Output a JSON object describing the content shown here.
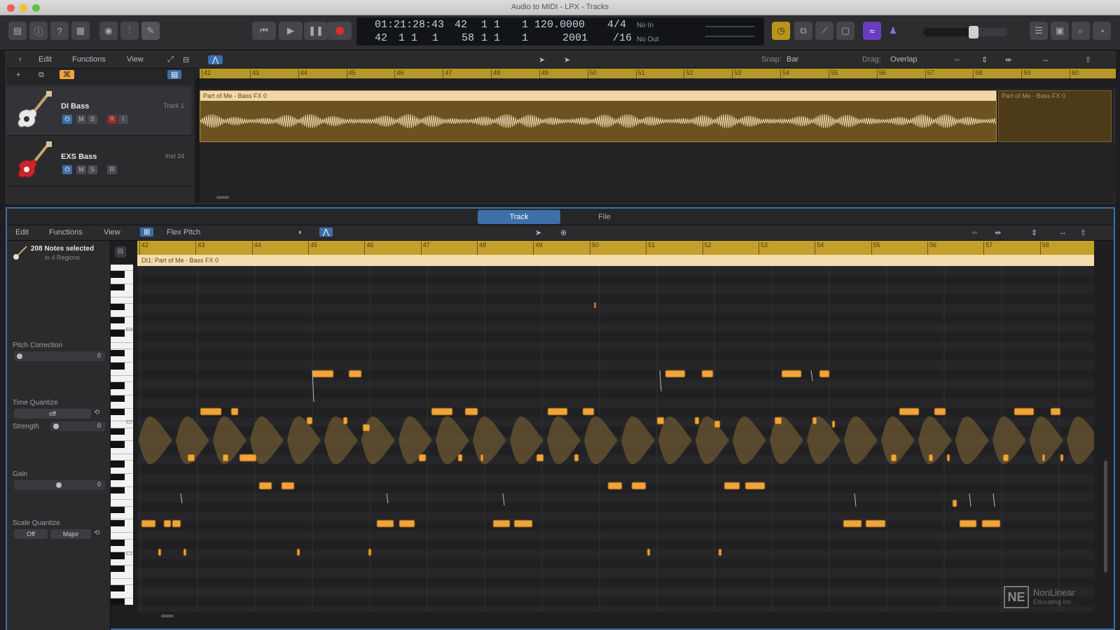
{
  "window": {
    "title": "Audio to MIDI - LPX - Tracks"
  },
  "colors": {
    "accent": "#3d6fa8",
    "region": "#b58d3a",
    "note": "#f0a43a",
    "ruler": "#c3a02c",
    "record": "#d62d2d"
  },
  "control_bar": {
    "icons": [
      "library-icon",
      "inspector-icon",
      "quick-help-icon",
      "toolbar-icon",
      "smart-controls-icon",
      "mixer-icon",
      "editors-icon"
    ],
    "transport": [
      "rewind-icon",
      "play-icon",
      "pause-icon",
      "record-icon"
    ],
    "lcd": {
      "time": "01:21:28:43",
      "bars_top": [
        "42",
        "1",
        "1",
        "1"
      ],
      "tempo": "120.0000",
      "signature": "4/4",
      "bars_bottom": [
        "42",
        "1",
        "1",
        "1"
      ],
      "bars_bottom_2": [
        "58",
        "1",
        "1",
        "1"
      ],
      "tempo_bottom": "2001",
      "division": "/16",
      "midi_in": "No In",
      "midi_out": "No Out"
    },
    "right_icons": [
      "metronome-icon",
      "count-in-icon",
      "tuner-icon",
      "solo-icon",
      "replace-icon",
      "tuning-icon"
    ],
    "volume": 0.6
  },
  "tracks_area": {
    "menu": [
      "Edit",
      "Functions",
      "View"
    ],
    "snap_label": "Snap:",
    "snap_value": "Bar",
    "drag_label": "Drag:",
    "drag_value": "Overlap",
    "ruler": [
      "42",
      "43",
      "44",
      "45",
      "46",
      "47",
      "48",
      "49",
      "50",
      "51",
      "52",
      "53",
      "54",
      "55",
      "56",
      "57",
      "58",
      "59",
      "60"
    ],
    "tracks": [
      {
        "name": "DI Bass",
        "sub": "Track 1",
        "buttons": [
          "M",
          "S",
          "R",
          "I"
        ]
      },
      {
        "name": "EXS Bass",
        "sub": "Inst 34",
        "buttons": [
          "M",
          "S",
          "R"
        ]
      }
    ],
    "region": {
      "name": "Part of Me - Bass FX 0"
    },
    "region_after": {
      "name": "Part of Me - Bass FX 0"
    }
  },
  "editor": {
    "tabs": [
      "Track",
      "File"
    ],
    "active_tab": "Track",
    "menu": [
      "Edit",
      "Functions",
      "View"
    ],
    "mode": "Flex Pitch",
    "selection": {
      "title": "208 Notes selected",
      "subtitle": "in 4 Regions"
    },
    "inspector": {
      "pitch_correction": "Pitch Correction",
      "pitch_value": "0",
      "time_quantize": "Time Quantize",
      "time_quantize_value": "off",
      "strength": "Strength",
      "strength_value": "0",
      "gain": "Gain",
      "gain_value": "0",
      "scale_quantize": "Scale Quantize",
      "scale_off": "Off",
      "scale_mode": "Major"
    },
    "ruler": [
      "42",
      "43",
      "44",
      "45",
      "46",
      "47",
      "48",
      "49",
      "50",
      "51",
      "52",
      "53",
      "54",
      "55",
      "56",
      "57",
      "58"
    ],
    "region": {
      "name": "DI1: Part of Me - Bass FX 0"
    },
    "key_labels": [
      "C3",
      "C2",
      "C1"
    ]
  },
  "watermark": {
    "logo": "NE",
    "line1": "NonLinear",
    "line2": "Educating Inc."
  }
}
